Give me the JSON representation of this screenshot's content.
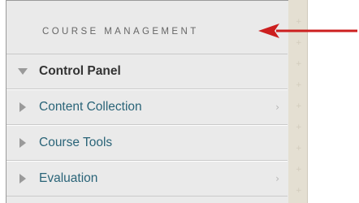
{
  "course_management": "COURSE MANAGEMENT",
  "menu": {
    "control_panel": "Control Panel",
    "items": [
      {
        "label": "Content Collection",
        "has_submenu_arrow": true,
        "icon": "triangle-right-icon"
      },
      {
        "label": "Course Tools",
        "has_submenu_arrow": false,
        "icon": "triangle-right-icon"
      },
      {
        "label": "Evaluation",
        "has_submenu_arrow": true,
        "icon": "triangle-right-icon"
      }
    ],
    "submenu_chevron": "›"
  },
  "annotation": {
    "arrow_color": "#cc1f1f"
  },
  "colors": {
    "link": "#2a6478",
    "panel_bg": "#eaeaea"
  }
}
